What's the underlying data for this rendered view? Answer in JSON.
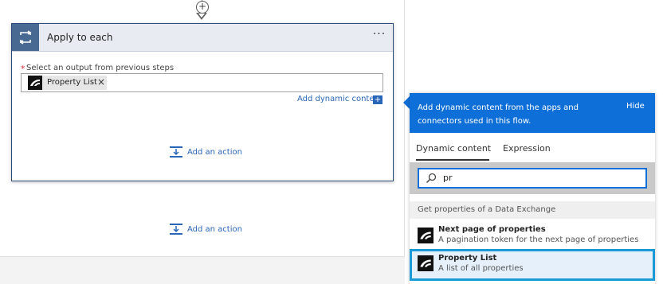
{
  "loop_card": {
    "title": "Apply to each",
    "more_label": "···",
    "required_mark": "*",
    "field_label": "Select an output from previous steps",
    "token_label": "Property List",
    "token_close": "×",
    "add_dynamic_label": "Add dynamic content",
    "add_dynamic_plus": "+",
    "add_action_inner": "Add an action"
  },
  "add_action_outer": "Add an action",
  "insert_step_plus": "+",
  "panel": {
    "header_text": "Add dynamic content from the apps and connectors used in this flow.",
    "hide_label": "Hide",
    "tabs": [
      {
        "label": "Dynamic content",
        "active": true
      },
      {
        "label": "Expression",
        "active": false
      }
    ],
    "search_value": "pr",
    "group_header": "Get properties of a Data Exchange",
    "items": [
      {
        "title": "Next page of properties",
        "description": "A pagination token for the next page of properties",
        "selected": false
      },
      {
        "title": "Property List",
        "description": "A list of all properties",
        "selected": true
      }
    ]
  },
  "colors": {
    "accent": "#0f6fd8",
    "loop_icon_bg": "#486991",
    "link": "#2a66b8",
    "selection_border": "#1a9bd7"
  },
  "icons": {
    "loop": "loop-icon",
    "connector": "data-exchange-icon",
    "add_action": "add-action-icon",
    "search": "search-icon"
  }
}
